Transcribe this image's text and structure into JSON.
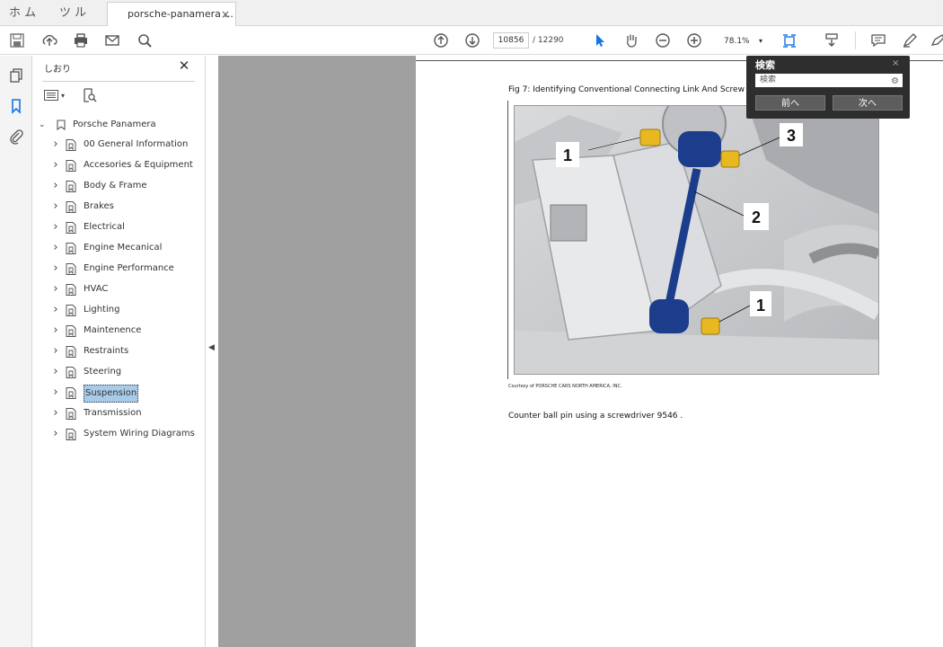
{
  "tabs": {
    "home": "ホ ム",
    "tools": "ツ ル",
    "document": "porsche-panamera ...",
    "close": "×"
  },
  "toolbar": {
    "page_current": "10856",
    "page_total": "/ 12290",
    "zoom": "78.1%",
    "zoom_caret": "▾"
  },
  "panel": {
    "title": "しおり",
    "close": "✕",
    "root_label": "Porsche Panamera",
    "items": [
      {
        "label": "00 General Information"
      },
      {
        "label": "Accesories & Equipment"
      },
      {
        "label": "Body & Frame"
      },
      {
        "label": "Brakes"
      },
      {
        "label": "Electrical"
      },
      {
        "label": "Engine Mecanical"
      },
      {
        "label": "Engine Performance"
      },
      {
        "label": "HVAC"
      },
      {
        "label": "Lighting"
      },
      {
        "label": "Maintenence"
      },
      {
        "label": "Restraints"
      },
      {
        "label": "Steering"
      },
      {
        "label": "Suspension"
      },
      {
        "label": "Transmission"
      },
      {
        "label": "System Wiring Diagrams"
      }
    ],
    "selected_index": 12
  },
  "document": {
    "fig_caption": "Fig 7: Identifying Conventional Connecting Link And Screw",
    "callouts": [
      "1",
      "3",
      "2",
      "1"
    ],
    "credit": "Courtesy of PORSCHE CARS NORTH AMERICA, INC.",
    "body_text": "Counter ball pin using a screwdriver 9546 ."
  },
  "find": {
    "title": "検索",
    "close": "×",
    "input_value": "検索",
    "prev": "前へ",
    "next": "次へ"
  },
  "colors": {
    "accent_blue": "#1473e6",
    "selection": "#a9cbea",
    "doc_background": "#a0a0a0",
    "part_blue": "#1c3d8c",
    "part_yellow": "#e8b820"
  }
}
